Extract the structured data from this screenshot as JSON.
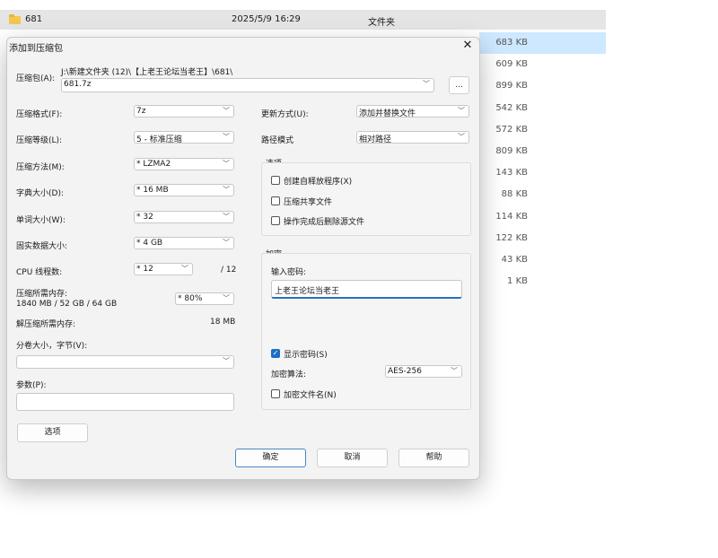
{
  "explorer": {
    "row": {
      "name": "681",
      "date": "2025/5/9 16:29",
      "type": "文件夹"
    },
    "sizes": [
      "683 KB",
      "609 KB",
      "899 KB",
      "542 KB",
      "572 KB",
      "809 KB",
      "143 KB",
      "88 KB",
      "114 KB",
      "122 KB",
      "43 KB",
      "1 KB"
    ]
  },
  "dialog": {
    "title": "添加到压缩包",
    "archive": {
      "label": "压缩包(A):",
      "path": "J:\\新建文件夹 (12)\\【上老王论坛当老王】\\681\\",
      "value": "681.7z",
      "browse": "..."
    },
    "left": {
      "format": {
        "label": "压缩格式(F):",
        "value": "7z"
      },
      "level": {
        "label": "压缩等级(L):",
        "value": "5 - 标准压缩"
      },
      "method": {
        "label": "压缩方法(M):",
        "value": "* LZMA2"
      },
      "dict": {
        "label": "字典大小(D):",
        "value": "* 16 MB"
      },
      "word": {
        "label": "单词大小(W):",
        "value": "* 32"
      },
      "solid": {
        "label": "固实数据大小:",
        "value": "* 4 GB"
      },
      "cpu": {
        "label": "CPU 线程数:",
        "value": "* 12",
        "max": "/ 12"
      },
      "mem": {
        "label": "压缩所需内存:",
        "detail": "1840 MB / 52 GB / 64 GB",
        "value": "* 80%"
      },
      "decomp": {
        "label": "解压缩所需内存:",
        "value": "18 MB"
      },
      "volume": {
        "label": "分卷大小，字节(V):",
        "value": ""
      },
      "params": {
        "label": "参数(P):",
        "value": ""
      },
      "options_btn": "选项"
    },
    "right": {
      "update": {
        "label": "更新方式(U):",
        "value": "添加并替换文件"
      },
      "path": {
        "label": "路径模式",
        "value": "相对路径"
      },
      "options": {
        "title": "选项",
        "sfx": "创建自释放程序(X)",
        "shared": "压缩共享文件",
        "delete": "操作完成后删除源文件"
      },
      "encryption": {
        "title": "加密",
        "pw_label": "输入密码:",
        "pw_value": "上老王论坛当老王",
        "show_pw": "显示密码(S)",
        "method_label": "加密算法:",
        "method_value": "AES-256",
        "encrypt_names": "加密文件名(N)"
      }
    },
    "buttons": {
      "ok": "确定",
      "cancel": "取消",
      "help": "帮助"
    }
  },
  "icons": {
    "close": "close-icon",
    "chevron": "chevron-down-icon",
    "folder": "folder-icon",
    "check": "check-icon"
  }
}
